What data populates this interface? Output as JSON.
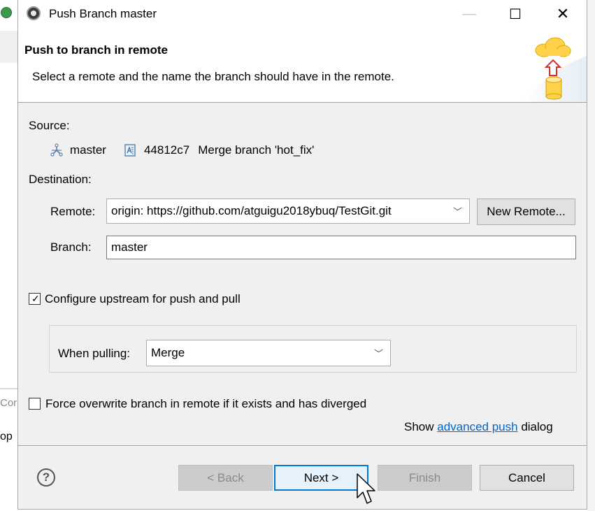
{
  "window": {
    "title": "Push Branch master",
    "minimize_glyph": "—",
    "maximize_glyph": "☐",
    "close_glyph": "✕"
  },
  "header": {
    "title": "Push to branch in remote",
    "description": "Select a remote and the name the branch should have in the remote."
  },
  "source": {
    "label": "Source:",
    "branch": "master",
    "commit_id": "44812c7",
    "commit_message": "Merge branch 'hot_fix'"
  },
  "destination": {
    "label": "Destination:",
    "remote_label": "Remote:",
    "remote_value": "origin: https://github.com/atguigu2018ybuq/TestGit.git",
    "new_remote_label": "New Remote...",
    "branch_label": "Branch:",
    "branch_value": "master"
  },
  "upstream": {
    "label": "Configure upstream for push and pull",
    "checked": true,
    "when_pulling_label": "When pulling:",
    "when_pulling_value": "Merge"
  },
  "force": {
    "label": "Force overwrite branch in remote if it exists and has diverged",
    "checked": false
  },
  "advanced": {
    "prefix": "Show",
    "link": "advanced push",
    "suffix": "dialog"
  },
  "buttons": {
    "help": "?",
    "back": "< Back",
    "next": "Next >",
    "finish": "Finish",
    "cancel": "Cancel"
  },
  "background": {
    "left_text_1": "Cor",
    "left_text_2": "op"
  },
  "colors": {
    "accent": "#0078d7",
    "link": "#0066cc",
    "dialog_bg": "#f0f0f0"
  }
}
